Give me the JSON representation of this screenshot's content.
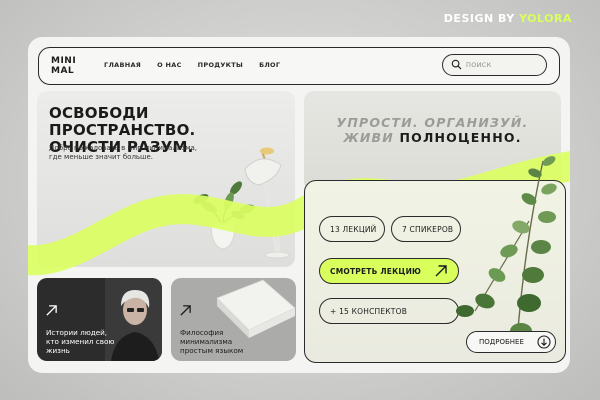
{
  "credit": {
    "prefix": "DESIGN BY ",
    "brand": "YOLORA"
  },
  "nav": {
    "logo_line1": "MINI",
    "logo_line2": "MAL",
    "items": [
      "ГЛАВНАЯ",
      "О НАС",
      "ПРОДУКТЫ",
      "БЛОГ"
    ],
    "search_placeholder": "ПОИСК"
  },
  "hero": {
    "title_line1": "ОСВОБОДИ ПРОСТРАНСТВО.",
    "title_line2": "ОЧИСТИ РАЗУМ.",
    "subtitle": "Добро пожаловать в мир минимализма, где меньше значит больше."
  },
  "tagline": {
    "line1": "УПРОСТИ. ОРГАНИЗУЙ.",
    "line2_light": "ЖИВИ ",
    "line2_bold": "ПОЛНОЦЕННО."
  },
  "stats": {
    "lectures": "13 ЛЕКЦИЙ",
    "speakers": "7 СПИКЕРОВ"
  },
  "cta": {
    "watch_label": "СМОТРЕТЬ ЛЕКЦИЮ",
    "notes_label": "+ 15 КОНСПЕКТОВ",
    "more_label": "ПОДРОБНЕЕ"
  },
  "cards": [
    {
      "text": "Истории людей, кто изменил свою жизнь"
    },
    {
      "text": "Философия минимализма простым языком"
    }
  ],
  "colors": {
    "accent": "#d9ff5c",
    "dark": "#1c1c1c",
    "frame": "#f4f4f2"
  }
}
